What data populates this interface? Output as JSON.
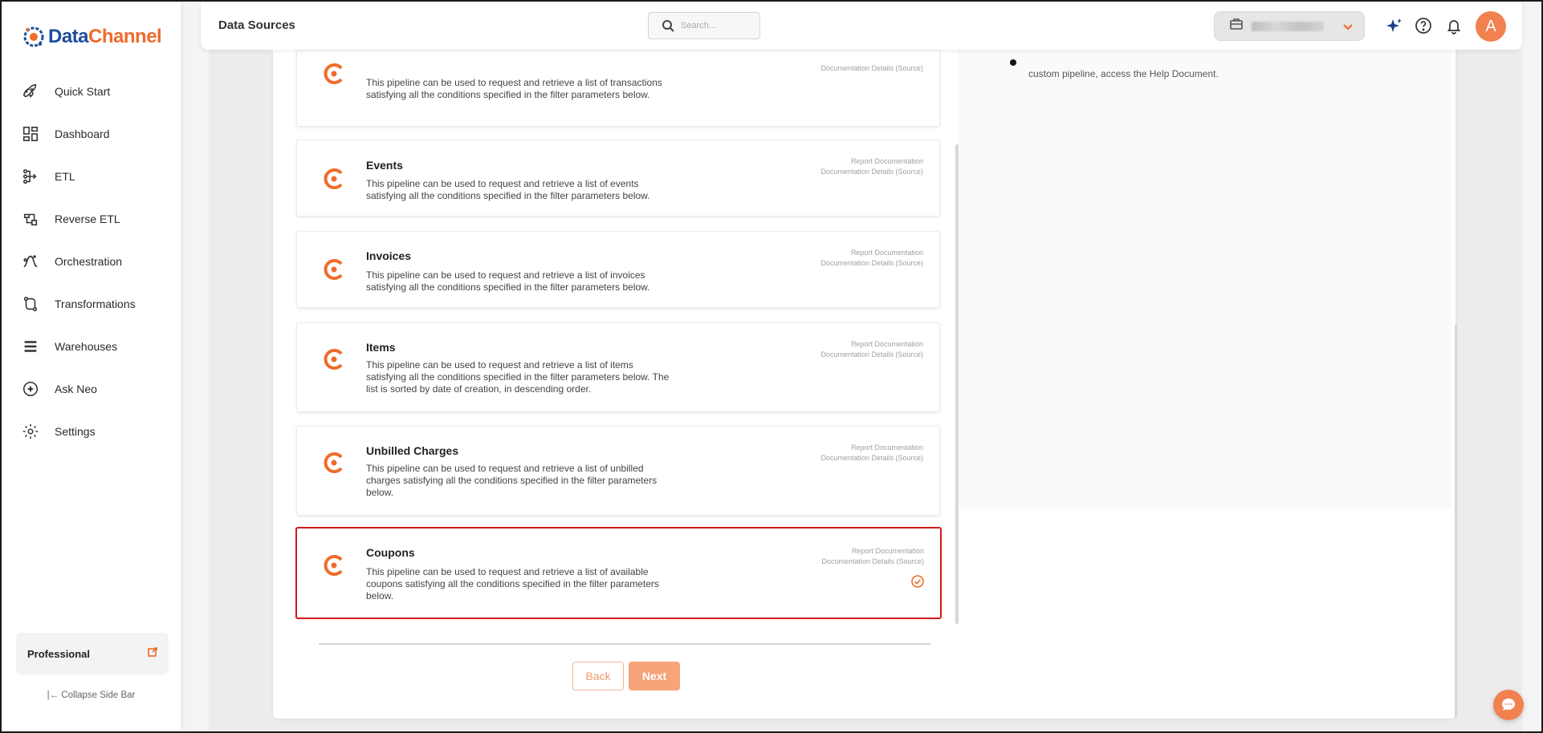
{
  "brand": {
    "data": "Data",
    "channel": "Channel"
  },
  "sidebar": {
    "items": [
      {
        "label": "Quick Start",
        "icon": "rocket-icon"
      },
      {
        "label": "Dashboard",
        "icon": "dashboard-icon"
      },
      {
        "label": "ETL",
        "icon": "etl-icon"
      },
      {
        "label": "Reverse ETL",
        "icon": "reverse-etl-icon"
      },
      {
        "label": "Orchestration",
        "icon": "orchestration-icon"
      },
      {
        "label": "Transformations",
        "icon": "transformations-icon"
      },
      {
        "label": "Warehouses",
        "icon": "warehouses-icon"
      },
      {
        "label": "Ask Neo",
        "icon": "ask-neo-icon"
      },
      {
        "label": "Settings",
        "icon": "settings-icon"
      }
    ],
    "plan_label": "Professional",
    "collapse_label": "|← Collapse Side Bar"
  },
  "header": {
    "title": "Data Sources",
    "search_placeholder": "Search..."
  },
  "user": {
    "avatar_initial": "A"
  },
  "right_pane": {
    "text": "custom pipeline, access the Help Document."
  },
  "doc_links": {
    "report": "Report Documentation",
    "details": "Documentation Details (Source)"
  },
  "pipelines": [
    {
      "title": "",
      "desc": "This pipeline can be used to request and retrieve a list of transactions satisfying all the conditions specified in the filter parameters below.",
      "selected": false
    },
    {
      "title": "Events",
      "desc": "This pipeline can be used to request and retrieve a list of events satisfying all the conditions specified in the filter parameters below.",
      "selected": false
    },
    {
      "title": "Invoices",
      "desc": "This pipeline can be used to request and retrieve a list of invoices satisfying all the conditions specified in the filter parameters below.",
      "selected": false
    },
    {
      "title": "Items",
      "desc": "This pipeline can be used to request and retrieve a list of items satisfying all the conditions specified in the filter parameters below. The list is sorted by date of creation, in descending order.",
      "selected": false
    },
    {
      "title": "Unbilled Charges",
      "desc": "This pipeline can be used to request and retrieve a list of unbilled charges satisfying all the conditions specified in the filter parameters below.",
      "selected": false
    },
    {
      "title": "Coupons",
      "desc": "This pipeline can be used to request and retrieve a list of available coupons satisfying all the conditions specified in the filter parameters below.",
      "selected": true
    }
  ],
  "buttons": {
    "back": "Back",
    "next": "Next"
  },
  "colors": {
    "accent": "#ef6c2b",
    "brand_blue": "#1f4e9b",
    "selected_border": "#d11919"
  }
}
